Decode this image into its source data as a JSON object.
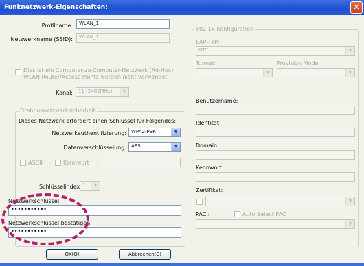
{
  "window": {
    "title": "Funknetzwerk-Eigenschaften:",
    "close_label": "✕"
  },
  "profile": {
    "name_label": "Profilname:",
    "name_value": "WLAN_1",
    "ssid_label": "Netzwerkname (SSID):",
    "ssid_value": "WLAN_1"
  },
  "adhoc": {
    "text_line1": "Dies ist ein Computer-zu-Computer-Netzwerk (Ad-Hoc);",
    "text_line2": "WLAN Router/Access Points werden nicht verwendet.",
    "channel_label": "Kanal:",
    "channel_value": "11 (2462MHz)"
  },
  "security": {
    "group_title": "Drahtlosnetzwerksicherheit",
    "intro": "Dieses Netzwerk erfordert einen Schlüssel für Folgendes:",
    "auth_label": "Netzwerkauthentifizierung:",
    "auth_value": "WPA2-PSK",
    "enc_label": "Datenverschlüsselung:",
    "enc_value": "AES",
    "ascii_label": "ASCII",
    "passphrase_label": "Kennwort",
    "key_index_label": "Schlüsselindex:",
    "key_index_value": "1",
    "key_label": "Netzwerkschlüssel:",
    "key_value": "•••••••••••",
    "confirm_label": "Netzwerkschlüssel bestätigen:",
    "confirm_value": "•••••••••••"
  },
  "eap": {
    "group_title": "802.1x-Konfiguration",
    "type_label": "EAP-TYP:",
    "type_value": "GTC",
    "tunnel_label": "Tunnel:",
    "provision_label": "Provision Mode :",
    "username_label": "Benutzername:",
    "identity_label": "Identität:",
    "domain_label": "Domain :",
    "password_label": "Kennwort:",
    "certificate_label": "Zertifikat:",
    "pac_label": "PAC :",
    "auto_pac_label": "Auto Select PAC"
  },
  "buttons": {
    "ok": "OK(O)",
    "cancel": "Abbrechen(C)"
  }
}
